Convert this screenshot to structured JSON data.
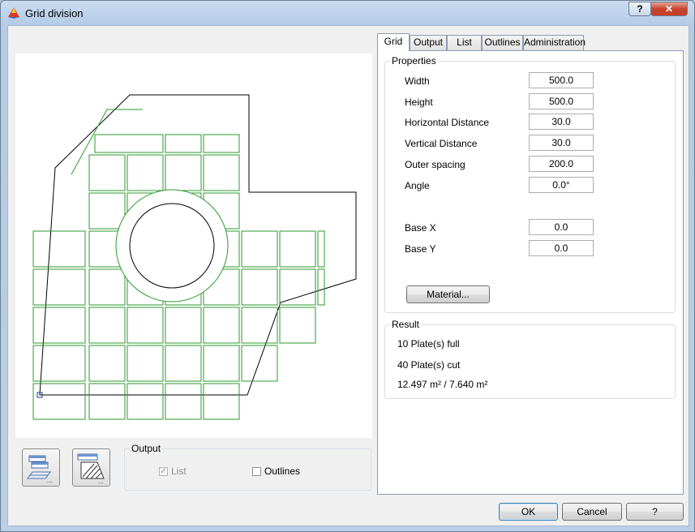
{
  "window": {
    "title": "Grid division",
    "help_label": "?",
    "close_label": "✕"
  },
  "tabs": [
    {
      "label": "Grid"
    },
    {
      "label": "Output"
    },
    {
      "label": "List"
    },
    {
      "label": "Outlines"
    },
    {
      "label": "Administration"
    }
  ],
  "properties": {
    "legend": "Properties",
    "width_label": "Width",
    "width_value": "500.0",
    "height_label": "Height",
    "height_value": "500.0",
    "hdist_label": "Horizontal Distance",
    "hdist_value": "30.0",
    "vdist_label": "Vertical Distance",
    "vdist_value": "30.0",
    "outer_label": "Outer spacing",
    "outer_value": "200.0",
    "angle_label": "Angle",
    "angle_value": "0.0°",
    "basex_label": "Base X",
    "basex_value": "0.0",
    "basey_label": "Base Y",
    "basey_value": "0.0",
    "material_button": "Material..."
  },
  "result": {
    "legend": "Result",
    "full": "10 Plate(s) full",
    "cut": "40 Plate(s) cut",
    "area": "12.497 m² / 7.640 m²"
  },
  "output": {
    "legend": "Output",
    "list_label": "List",
    "list_checked": true,
    "list_enabled": false,
    "outlines_label": "Outlines",
    "outlines_checked": false
  },
  "buttons": {
    "ok": "OK",
    "cancel": "Cancel",
    "help": "?"
  },
  "icons": {
    "title": "app-icon",
    "left_button": "layers-list-icon",
    "right_button": "hatch-grid-icon"
  },
  "colors": {
    "grid_lines": "#2e9a2e",
    "outline": "#000000"
  }
}
